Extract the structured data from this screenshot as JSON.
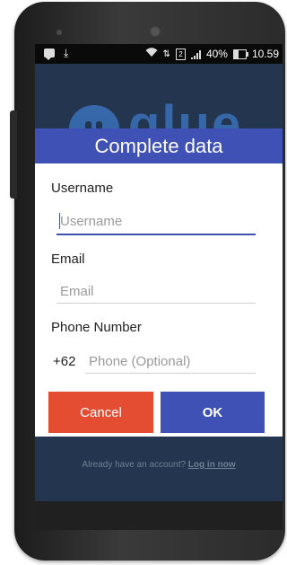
{
  "status_bar": {
    "battery_percent": "40%",
    "time": "10.59",
    "sim_slot": "2"
  },
  "background": {
    "logo_text": "glue"
  },
  "dialog": {
    "title": "Complete data",
    "username": {
      "label": "Username",
      "placeholder": "Username",
      "value": ""
    },
    "email": {
      "label": "Email",
      "placeholder": "Email",
      "value": ""
    },
    "phone": {
      "label": "Phone Number",
      "prefix": "+62",
      "placeholder": "Phone (Optional)",
      "value": ""
    },
    "cancel_label": "Cancel",
    "ok_label": "OK"
  },
  "footer": {
    "text": "Already have an account?",
    "link": "Log in now"
  },
  "colors": {
    "header": "#3f51b5",
    "cancel": "#e54d33",
    "ok": "#3f51b5"
  }
}
